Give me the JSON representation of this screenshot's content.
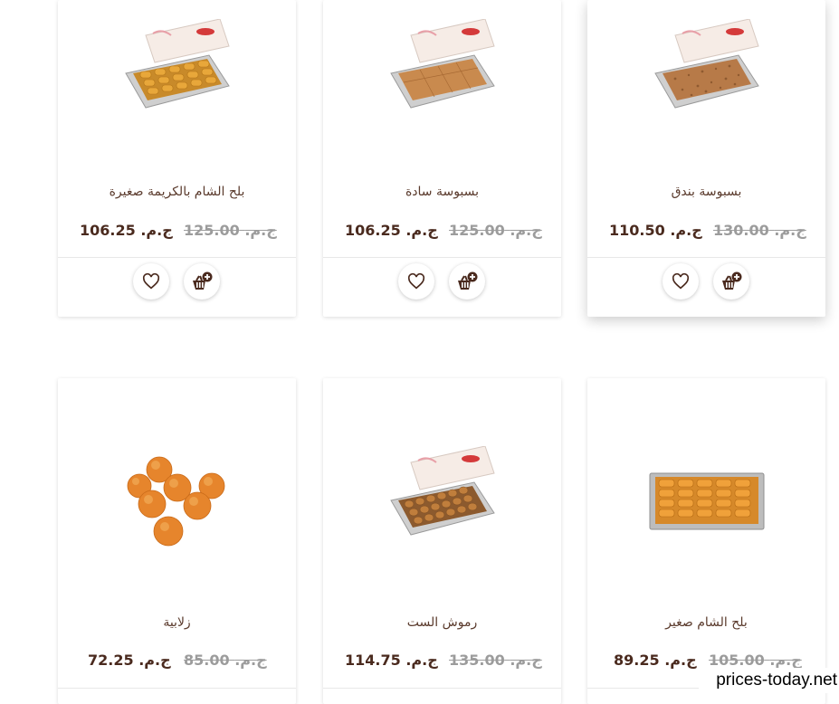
{
  "currency": "ج.م.",
  "products": [
    {
      "name": "بلح الشام بالكريمة صغيرة",
      "price": "106.25",
      "old_price": "125.00"
    },
    {
      "name": "بسبوسة سادة",
      "price": "106.25",
      "old_price": "125.00"
    },
    {
      "name": "بسبوسة بندق",
      "price": "110.50",
      "old_price": "130.00"
    },
    {
      "name": "زلابية",
      "price": "72.25",
      "old_price": "85.00"
    },
    {
      "name": "رموش الست",
      "price": "114.75",
      "old_price": "135.00"
    },
    {
      "name": "بلح الشام صغير",
      "price": "89.25",
      "old_price": "105.00"
    }
  ],
  "buttons": {
    "wishlist_icon": "heart-icon",
    "cart_icon": "basket-plus-icon"
  },
  "colors": {
    "accent": "#4a2a1e",
    "old_price": "#9c9c9c",
    "name": "#5a3a2c"
  },
  "watermark": "prices-today.net"
}
